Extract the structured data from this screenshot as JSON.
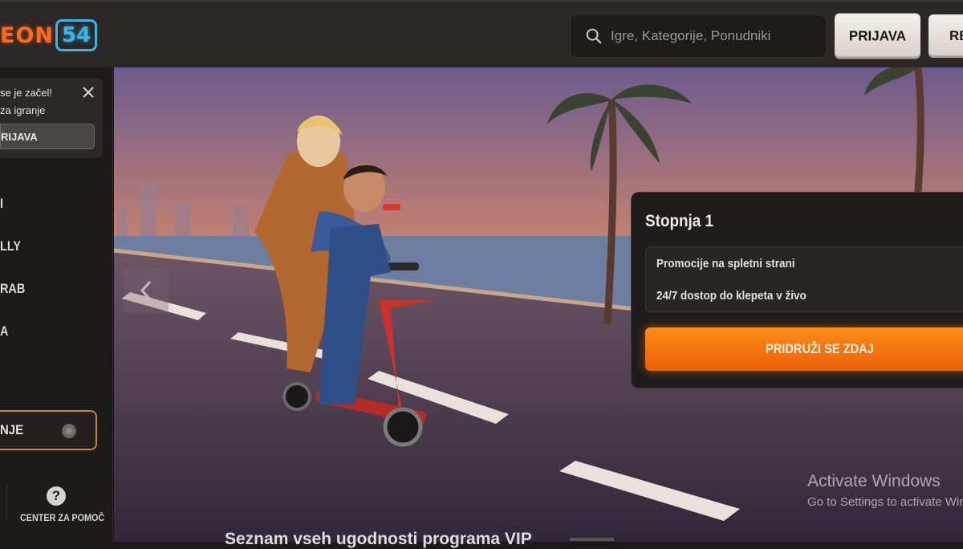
{
  "header": {
    "logo_text": "EON",
    "logo_number": "54",
    "search_placeholder": "Igre, Kategorije, Ponudniki",
    "login_label": "PRIJAVA",
    "register_label": "RE"
  },
  "sidebar": {
    "notice": {
      "line1": "se je začel!",
      "line2": "za igranje",
      "button_label": "RIJAVA"
    },
    "nav_items": [
      "I",
      "LLY",
      "RAB",
      "A"
    ],
    "language_label": "NJE",
    "help_label": "CENTER ZA POMOČ",
    "help_icon": "?"
  },
  "hero": {
    "colors": {
      "sky_top": "#6d5b8e",
      "sky_mid": "#d88a6a",
      "horizon": "#f3b27a",
      "road": "#3b3246",
      "scooter": "#c8332d"
    }
  },
  "vip_card": {
    "level": "Stopnja 1",
    "benefits": [
      "Promocije na spletni strani",
      "24/7 dostop do klepeta v živo"
    ],
    "join_label": "PRIDRUŽI SE ZDAJ"
  },
  "watermark": {
    "line1": "Activate Windows",
    "line2": "Go to Settings to activate Windows."
  },
  "bottom_heading": "Seznam vseh ugodnosti programa VIP"
}
